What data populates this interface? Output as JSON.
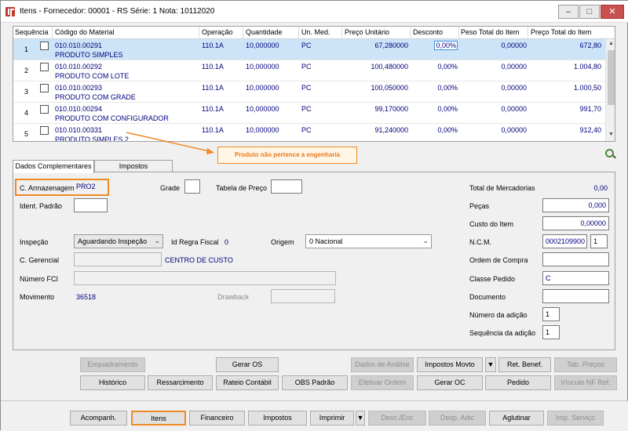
{
  "window": {
    "title": "Itens - Fornecedor: 00001 - RS Série: 1     Nota: 10112020"
  },
  "grid": {
    "headers": [
      "Sequência",
      "Código do Material",
      "Operação",
      "Quantidade",
      "Un. Med.",
      "Preço Unitário",
      "Desconto",
      "Peso Total do Item",
      "Preço Total do Item"
    ],
    "rows": [
      {
        "seq": "1",
        "code": "010.010.00291",
        "desc": "PRODUTO SIMPLES",
        "op": "110.1A",
        "qty": "10,000000",
        "un": "PC",
        "pu": "67,280000",
        "dsc": "0,00%",
        "pt": "0,00000",
        "ptot": "672,80"
      },
      {
        "seq": "2",
        "code": "010.010.00292",
        "desc": "PRODUTO COM LOTE",
        "op": "110.1A",
        "qty": "10,000000",
        "un": "PC",
        "pu": "100,480000",
        "dsc": "0,00%",
        "pt": "0,00000",
        "ptot": "1.004,80"
      },
      {
        "seq": "3",
        "code": "010.010.00293",
        "desc": "PRODUTO COM GRADE",
        "op": "110.1A",
        "qty": "10,000000",
        "un": "PC",
        "pu": "100,050000",
        "dsc": "0,00%",
        "pt": "0,00000",
        "ptot": "1.000,50"
      },
      {
        "seq": "4",
        "code": "010.010.00294",
        "desc": "PRODUTO COM CONFIGURADOR",
        "op": "110.1A",
        "qty": "10,000000",
        "un": "PC",
        "pu": "99,170000",
        "dsc": "0,00%",
        "pt": "0,00000",
        "ptot": "991,70"
      },
      {
        "seq": "5",
        "code": "010.010.00331",
        "desc": "PRODUTO SIMPLES 2",
        "op": "110.1A",
        "qty": "10,000000",
        "un": "PC",
        "pu": "91,240000",
        "dsc": "0,00%",
        "pt": "0,00000",
        "ptot": "912,40"
      }
    ]
  },
  "tooltip": "Produto não pertence a engenharia",
  "tabs": [
    "Dados Complementares",
    "Impostos"
  ],
  "form": {
    "armazenagem_label": "C. Armazenagem",
    "armazenagem_value": "PRO2",
    "grade_label": "Grade",
    "tabela_label": "Tabela de Preço",
    "ident_label": "Ident. Padrão",
    "inspecao_label": "Inspeção",
    "inspecao_value": "Aguardando Inspeção",
    "regra_label": "Id Regra Fiscal",
    "regra_value": "0",
    "origem_label": "Origem",
    "origem_value": "0 Nacional",
    "gerencial_label": "C. Gerencial",
    "gerencial_value": "CENTRO DE CUSTO",
    "fci_label": "Número FCI",
    "movimento_label": "Movimento",
    "movimento_value": "36518",
    "drawback_label": "Drawback"
  },
  "right": {
    "total_label": "Total de Mercadorias",
    "total_value": "0,00",
    "pecas_label": "Peças",
    "pecas_value": "0,000",
    "custo_label": "Custo do Item",
    "custo_value": "0,00000",
    "ncm_label": "N.C.M.",
    "ncm_value": "0002109900",
    "ncm_value2": "1",
    "ordem_label": "Ordem de Compra",
    "classe_label": "Classe Pedido",
    "classe_value": "C",
    "documento_label": "Documento",
    "nadicao_label": "Número da adição",
    "nadicao_value": "1",
    "seqadicao_label": "Sequência da adição",
    "seqadicao_value": "1"
  },
  "buttons_row1": [
    "Enquadramento",
    "Gerar OS",
    "Dados de Análise",
    "Impostos Movto",
    "Ret. Benef.",
    "Tab. Preços"
  ],
  "buttons_row2": [
    "Histórico",
    "Ressarcimento",
    "Rateio Contábil",
    "OBS Padrão",
    "Efetivar Ordem",
    "Gerar OC",
    "Pedido",
    "Vínculo NF Ref."
  ],
  "bottom_buttons": [
    "Acompanh.",
    "Itens",
    "Financeiro",
    "Impostos",
    "Imprimir",
    "Desc./Enc",
    "Desp. Adic",
    "Aglutinar",
    "Imp. Serviço"
  ]
}
